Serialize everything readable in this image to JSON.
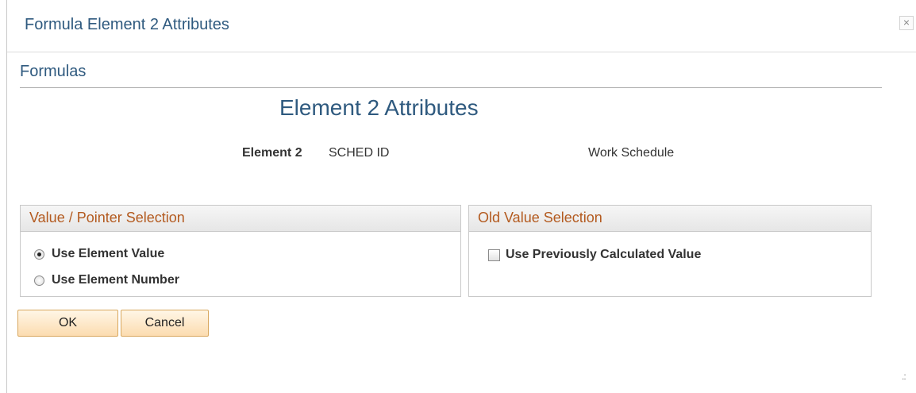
{
  "window": {
    "title": "Formula Element 2 Attributes",
    "close_symbol": "×"
  },
  "page": {
    "heading": "Formulas",
    "section_title": "Element 2 Attributes",
    "element_label": "Element 2",
    "element_code": "SCHED ID",
    "element_description": "Work Schedule"
  },
  "value_pointer_group": {
    "title": "Value / Pointer Selection",
    "options": [
      {
        "label": "Use Element Value",
        "selected": true
      },
      {
        "label": "Use Element Number",
        "selected": false
      }
    ]
  },
  "old_value_group": {
    "title": "Old Value Selection",
    "checkbox_label": "Use Previously Calculated Value",
    "checked": false
  },
  "buttons": {
    "ok": "OK",
    "cancel": "Cancel"
  },
  "icons": {
    "close": "close-icon",
    "resize": "resize-grip-icon"
  }
}
